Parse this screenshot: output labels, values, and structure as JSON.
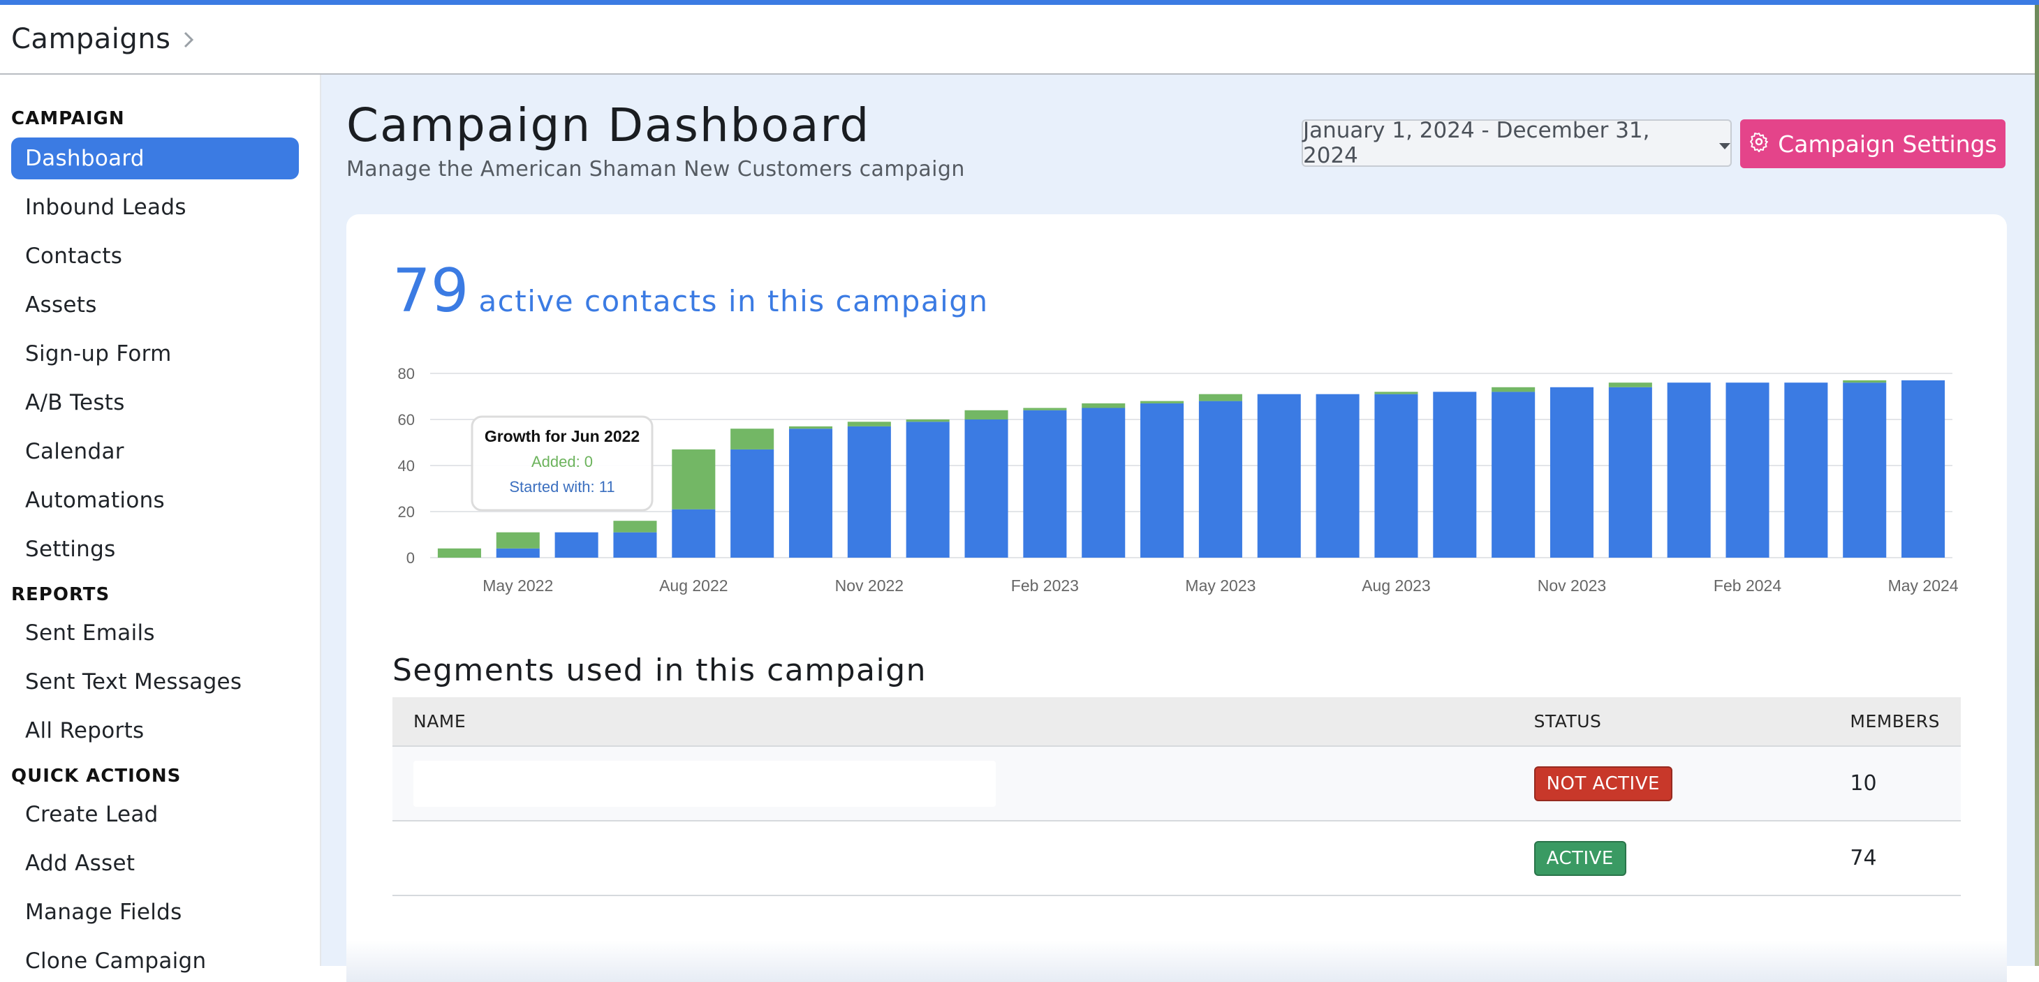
{
  "topbar": {
    "breadcrumb": "Campaigns"
  },
  "sidebar": {
    "campaign_heading": "CAMPAIGN",
    "campaign_items": [
      "Dashboard",
      "Inbound Leads",
      "Contacts",
      "Assets",
      "Sign-up Form",
      "A/B Tests",
      "Calendar",
      "Automations",
      "Settings"
    ],
    "reports_heading": "REPORTS",
    "reports_items": [
      "Sent Emails",
      "Sent Text Messages",
      "All Reports"
    ],
    "quick_heading": "QUICK ACTIONS",
    "quick_items": [
      "Create Lead",
      "Add Asset",
      "Manage Fields",
      "Clone Campaign"
    ]
  },
  "header": {
    "title": "Campaign Dashboard",
    "subtitle": "Manage the American Shaman New Customers campaign",
    "date_range": "January 1, 2024 - December 31, 2024",
    "settings_label": "Campaign Settings"
  },
  "summary": {
    "count": "79",
    "label": "active contacts in this campaign"
  },
  "chart_data": {
    "type": "bar",
    "stacked": true,
    "categories": [
      "Apr 2022",
      "May 2022",
      "Jun 2022",
      "Jul 2022",
      "Aug 2022",
      "Sep 2022",
      "Oct 2022",
      "Nov 2022",
      "Dec 2022",
      "Jan 2023",
      "Feb 2023",
      "Mar 2023",
      "Apr 2023",
      "May 2023",
      "Jun 2023",
      "Jul 2023",
      "Aug 2023",
      "Sep 2023",
      "Oct 2023",
      "Nov 2023",
      "Dec 2023",
      "Jan 2024",
      "Feb 2024",
      "Mar 2024",
      "Apr 2024",
      "May 2024"
    ],
    "x_tick_labels": [
      "May 2022",
      "Aug 2022",
      "Nov 2022",
      "Feb 2023",
      "May 2023",
      "Aug 2023",
      "Nov 2023",
      "Feb 2024",
      "May 2024"
    ],
    "series": [
      {
        "name": "Started with",
        "color": "#3b7be3",
        "values": [
          0,
          4,
          11,
          11,
          21,
          47,
          56,
          57,
          59,
          60,
          64,
          65,
          67,
          68,
          71,
          71,
          71,
          72,
          72,
          74,
          74,
          76,
          76,
          76,
          76,
          77
        ]
      },
      {
        "name": "Added",
        "color": "#73b765",
        "values": [
          4,
          7,
          0,
          5,
          26,
          9,
          1,
          2,
          1,
          4,
          1,
          2,
          1,
          3,
          0,
          0,
          1,
          0,
          2,
          0,
          2,
          0,
          0,
          0,
          1,
          0
        ]
      }
    ],
    "ylim": [
      0,
      80
    ],
    "yticks": [
      0,
      20,
      40,
      60,
      80
    ],
    "grid": true,
    "tooltip": {
      "title": "Growth for Jun 2022",
      "added": "Added: 0",
      "started": "Started with: 11",
      "index": 2
    }
  },
  "segments": {
    "title": "Segments used in this campaign",
    "columns": [
      "NAME",
      "STATUS",
      "MEMBERS"
    ],
    "rows": [
      {
        "name": "",
        "status": "NOT ACTIVE",
        "members": "10"
      },
      {
        "name": "",
        "status": "ACTIVE",
        "members": "74"
      }
    ]
  }
}
